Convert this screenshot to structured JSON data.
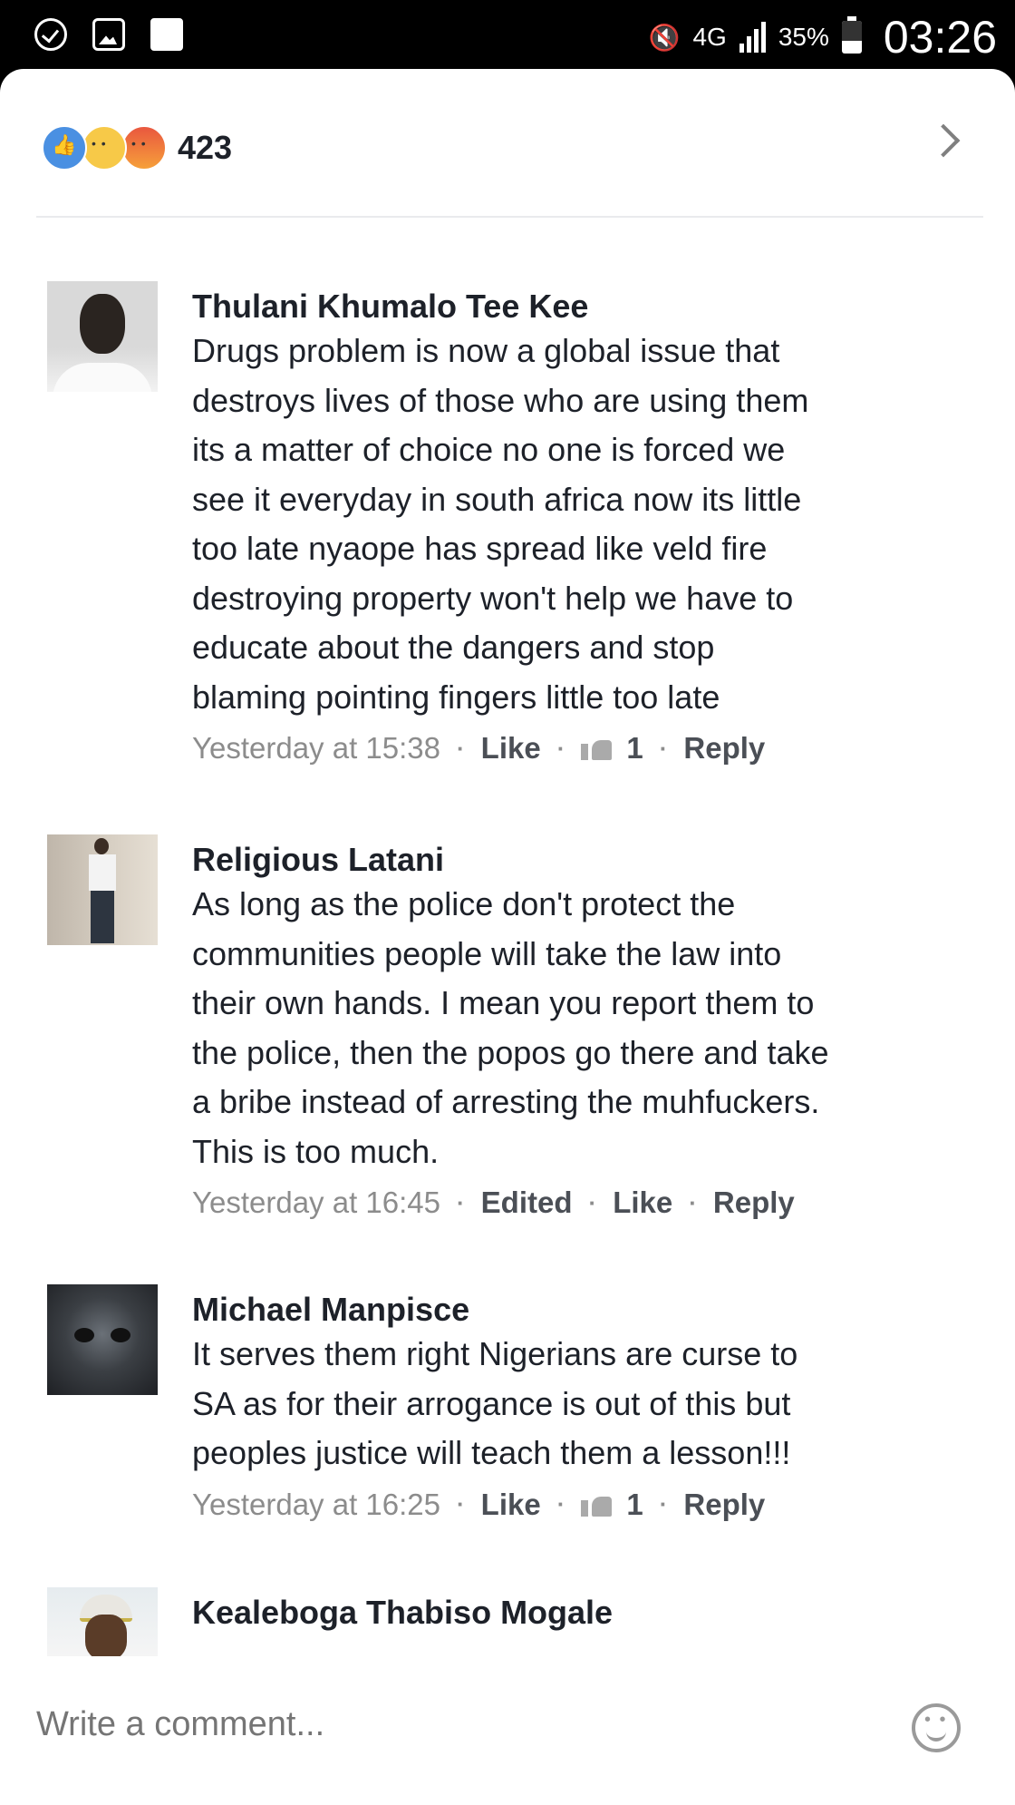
{
  "status_bar": {
    "network": "4G",
    "battery": "35%",
    "time": "03:26"
  },
  "reactions": {
    "count": "423",
    "types": [
      "like-icon",
      "sad-icon",
      "angry-icon"
    ]
  },
  "comments": [
    {
      "author": "Thulani Khumalo Tee Kee",
      "lines": [
        "Drugs problem is now a global issue that",
        "destroys lives of those who are using them",
        "its a matter of choice no one is forced we",
        "see it everyday in south africa now its little",
        "too late nyaope has spread like veld fire",
        "destroying property won't help we have to",
        "educate about the dangers and stop",
        "blaming pointing fingers little too late"
      ],
      "time": "Yesterday at 15:38",
      "like": "Like",
      "like_count": "1",
      "reply": "Reply"
    },
    {
      "author": "Religious Latani",
      "lines": [
        "As long as the police don't protect the",
        "communities people will take the law into",
        "their own hands. I mean you report them to",
        "the police, then the popos go there and take",
        "a bribe instead of arresting the muhfuckers.",
        "This is too much."
      ],
      "time": "Yesterday at 16:45",
      "edited": "Edited",
      "like": "Like",
      "reply": "Reply"
    },
    {
      "author": "Michael Manpisce",
      "lines": [
        "It serves them right Nigerians are curse to",
        "SA as for their arrogance is out of this but",
        "peoples justice will teach them a lesson!!!"
      ],
      "time": "Yesterday at 16:25",
      "like": "Like",
      "like_count": "1",
      "reply": "Reply"
    },
    {
      "author": "Kealeboga Thabiso Mogale"
    }
  ],
  "composer": {
    "placeholder": "Write a comment..."
  }
}
